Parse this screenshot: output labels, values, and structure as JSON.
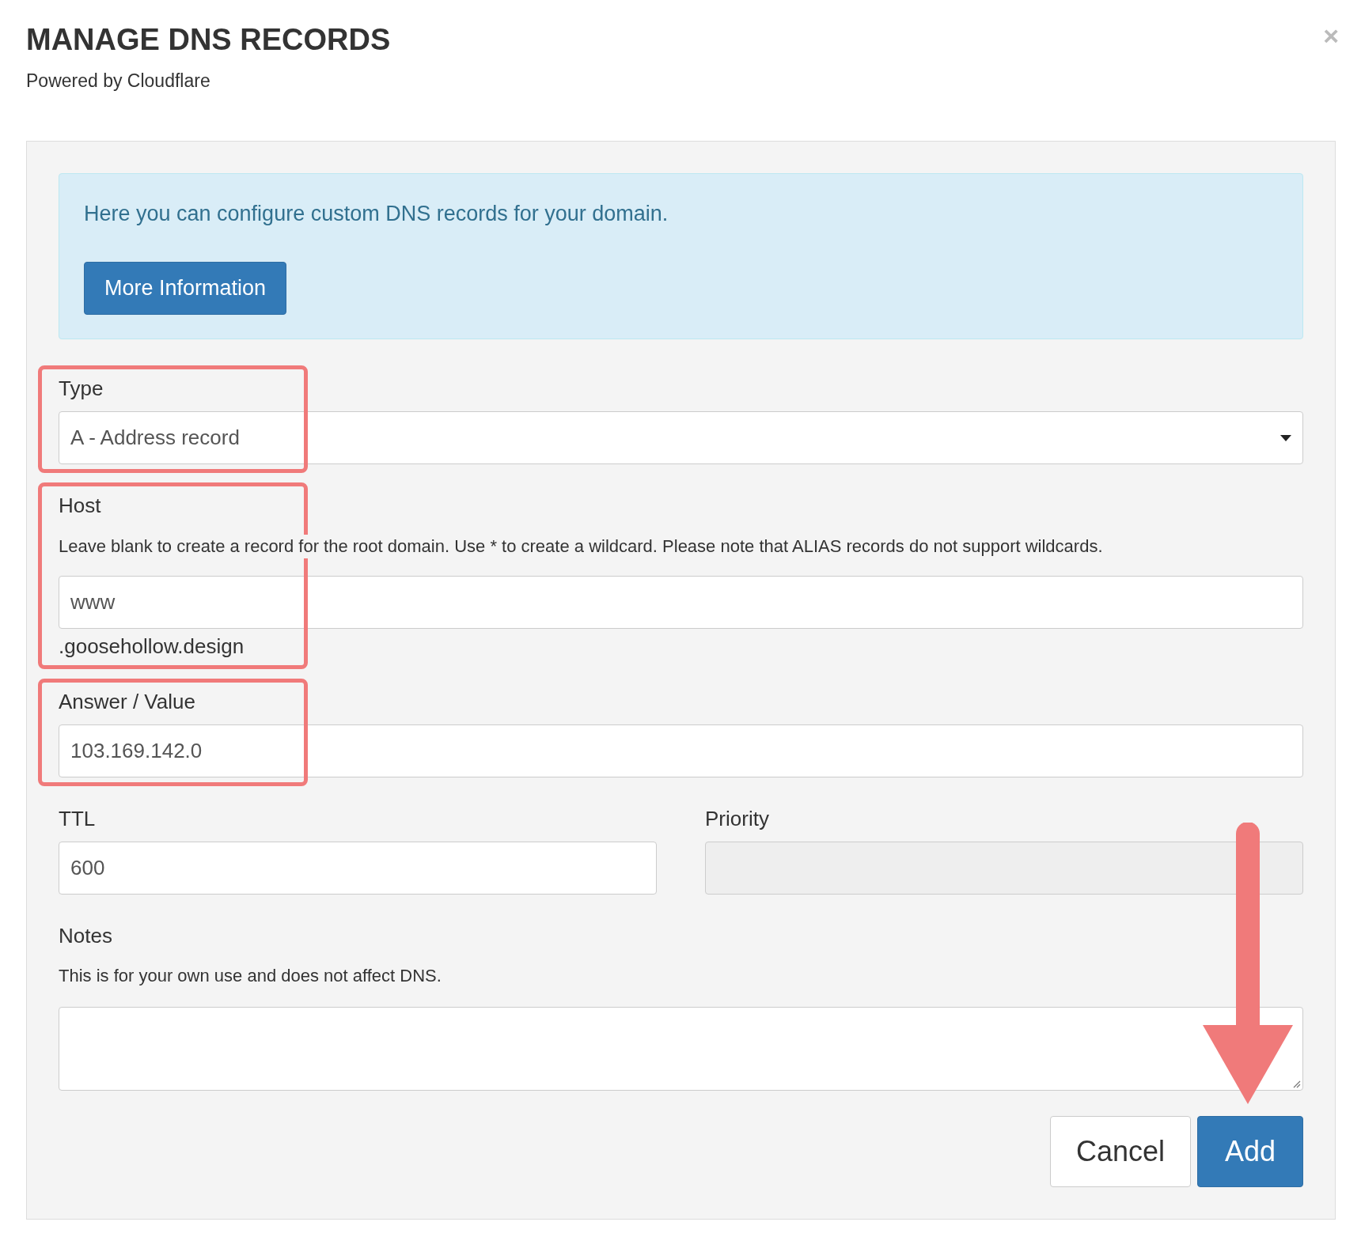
{
  "dialog": {
    "title": "MANAGE DNS RECORDS",
    "subtitle": "Powered by Cloudflare",
    "close": "×"
  },
  "info": {
    "text": "Here you can configure custom DNS records for your domain.",
    "button": "More Information"
  },
  "fields": [
    {
      "kind": "select",
      "label": "Type",
      "value": "A - Address record",
      "highlighted": true
    },
    {
      "kind": "text",
      "label": "Host",
      "help": "Leave blank to create a record for the root domain. Use * to create a wildcard. Please note that ALIAS records do not support wildcards.",
      "value": "www",
      "suffix": ".goosehollow.design",
      "highlighted": true
    },
    {
      "kind": "text",
      "label": "Answer / Value",
      "value": "103.169.142.0",
      "highlighted": true
    }
  ],
  "ttl": {
    "label": "TTL",
    "value": "600",
    "disabled": false
  },
  "priority": {
    "label": "Priority",
    "disabled": true
  },
  "notes": {
    "label": "Notes",
    "help": "This is for your own use and does not affect DNS."
  },
  "buttons": [
    {
      "label": "Cancel",
      "kind": "default"
    },
    {
      "label": "Add",
      "kind": "primary"
    }
  ]
}
